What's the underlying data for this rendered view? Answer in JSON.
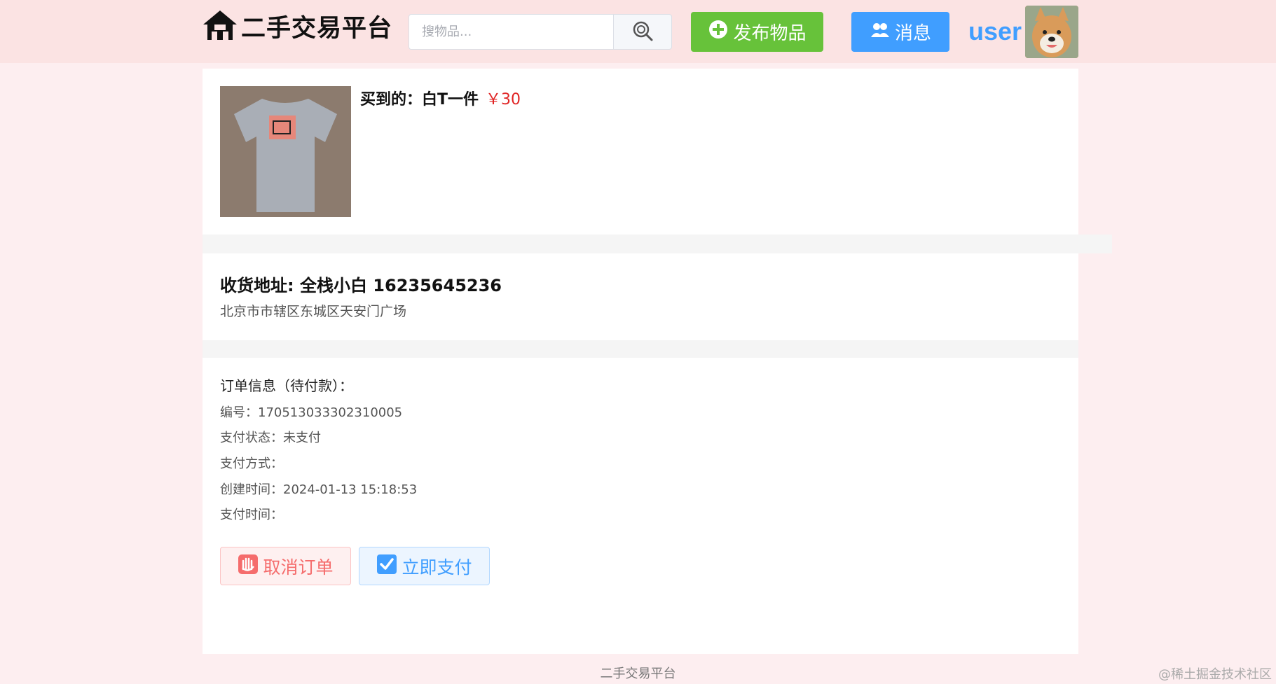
{
  "header": {
    "site_name": "二手交易平台",
    "search_placeholder": "搜物品...",
    "publish_label": "发布物品",
    "message_label": "消息",
    "username": "user"
  },
  "product": {
    "title": "买到的：白T一件",
    "price": "￥30"
  },
  "address": {
    "title": "收货地址: 全栈小白 16235645236",
    "line": "北京市市辖区东城区天安门广场"
  },
  "order": {
    "heading": "订单信息（待付款）：",
    "rows": [
      "编号：170513033302310005",
      "支付状态：未支付",
      "支付方式：",
      "创建时间：2024-01-13 15:18:53",
      "支付时间："
    ],
    "cancel_label": "取消订单",
    "pay_label": "立即支付"
  },
  "footer": {
    "text": "二手交易平台"
  },
  "watermark": "@稀土掘金技术社区",
  "colors": {
    "header_bg": "#fbe3e3",
    "page_bg": "#fdeef0",
    "success": "#67c23a",
    "primary": "#409eff",
    "danger": "#f56c6c",
    "price": "#e02424"
  }
}
